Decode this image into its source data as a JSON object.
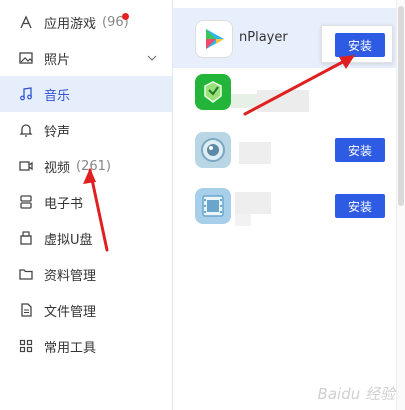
{
  "sidebar": {
    "items": [
      {
        "label": "应用游戏",
        "count": "(96)",
        "icon": "apps-icon",
        "badge": true
      },
      {
        "label": "照片",
        "count": "",
        "icon": "photo-icon",
        "expandable": true
      },
      {
        "label": "音乐",
        "count": "",
        "icon": "music-icon",
        "active": true
      },
      {
        "label": "铃声",
        "count": "",
        "icon": "bell-icon"
      },
      {
        "label": "视频",
        "count": "(261)",
        "icon": "video-icon"
      },
      {
        "label": "电子书",
        "count": "",
        "icon": "ebook-icon"
      },
      {
        "label": "虚拟U盘",
        "count": "",
        "icon": "usb-drive-icon"
      },
      {
        "label": "资料管理",
        "count": "",
        "icon": "folder-icon"
      },
      {
        "label": "文件管理",
        "count": "",
        "icon": "file-icon"
      },
      {
        "label": "常用工具",
        "count": "",
        "icon": "tools-grid-icon"
      }
    ]
  },
  "main": {
    "apps": [
      {
        "name": "nPlayer",
        "install_label": "安装",
        "icon": "nplayer-icon",
        "selected": true
      },
      {
        "name": "",
        "install_label": "",
        "icon": "green-app-icon"
      },
      {
        "name": "",
        "install_label": "安装",
        "icon": "lens-app-icon"
      },
      {
        "name": "",
        "install_label": "安装",
        "icon": "film-app-icon"
      }
    ]
  },
  "watermark": "Baidu 经验",
  "colors": {
    "accent": "#2d5be3",
    "active_bg": "#e6eefb",
    "badge": "#e32222",
    "arrow": "#e02020"
  }
}
